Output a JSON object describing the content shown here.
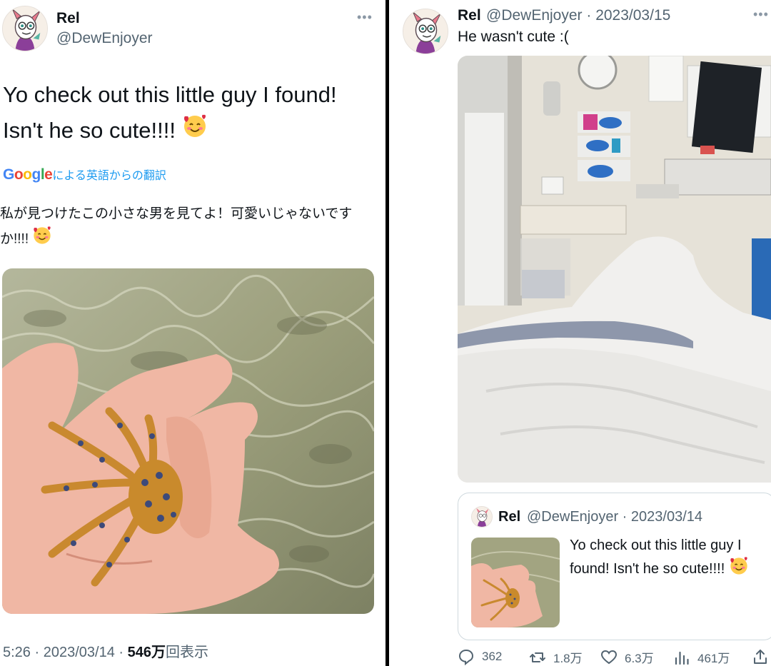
{
  "left_tweet": {
    "display_name": "Rel",
    "handle": "@DewEnjoyer",
    "text": "Yo check out this little guy I found! Isn't he so cute!!!!",
    "translate": {
      "brand": "Google",
      "label": "による英語からの翻訳"
    },
    "translated_text": "私が見つけたこの小さな男を見てよ！可愛いじゃないですか!!!!",
    "meta": {
      "time": "5:26",
      "date": "2023/03/14",
      "views_count": "546万",
      "views_label": "回表示"
    }
  },
  "right_tweet": {
    "display_name": "Rel",
    "handle": "@DewEnjoyer",
    "date": "2023/03/15",
    "text": "He wasn't cute :(",
    "quoted": {
      "display_name": "Rel",
      "handle": "@DewEnjoyer",
      "date": "2023/03/14",
      "text": "Yo check out this little guy I found! Isn't he so cute!!!!"
    },
    "actions": {
      "replies": "362",
      "retweets": "1.8万",
      "likes": "6.3万",
      "views": "461万"
    }
  },
  "icons": [
    "more-icon",
    "reply-icon",
    "retweet-icon",
    "like-icon",
    "views-icon",
    "share-icon",
    "smiling-hearts-emoji"
  ],
  "colors": {
    "text": "#0f1419",
    "secondary": "#536471",
    "link": "#1d9bf0",
    "border": "#cfd9de",
    "divider": "#000000"
  }
}
